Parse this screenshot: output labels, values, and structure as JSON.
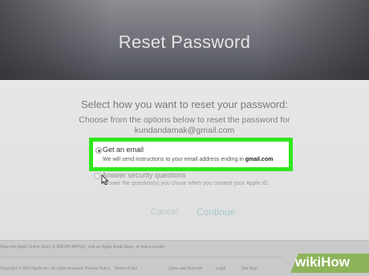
{
  "page": {
    "title": "Reset Password"
  },
  "main": {
    "headline": "Select how you want to reset your password:",
    "instruction": "Choose from the options below to reset the password for",
    "email": "kundandamak@gmail.com"
  },
  "options": [
    {
      "label": "Get an email",
      "description_prefix": "We will send instructions to your email address ending in",
      "description_bold": "gmail.com",
      "selected": true,
      "highlight_color": "#2fe81c"
    },
    {
      "label": "Answer security questions",
      "description": "Answer the question(s) you chose when you created your Apple ID.",
      "selected": false
    }
  ],
  "actions": {
    "cancel_label": "Cancel",
    "continue_label": "Continue"
  },
  "footer": {
    "shop_text": "Shop the Apple Online Store (1-800-MY-APPLE), visit an Apple Retail Store, or find a reseller.",
    "links": [
      "Privacy Policy",
      "Terms of Use",
      "Sales and Refunds",
      "Legal",
      "Site Map"
    ],
    "copyright": "Copyright © 2016 Apple Inc. All rights reserved."
  },
  "watermark": {
    "wiki": "wiki",
    "how": "How"
  },
  "icons": {
    "cursor": "mouse-pointer-icon"
  }
}
